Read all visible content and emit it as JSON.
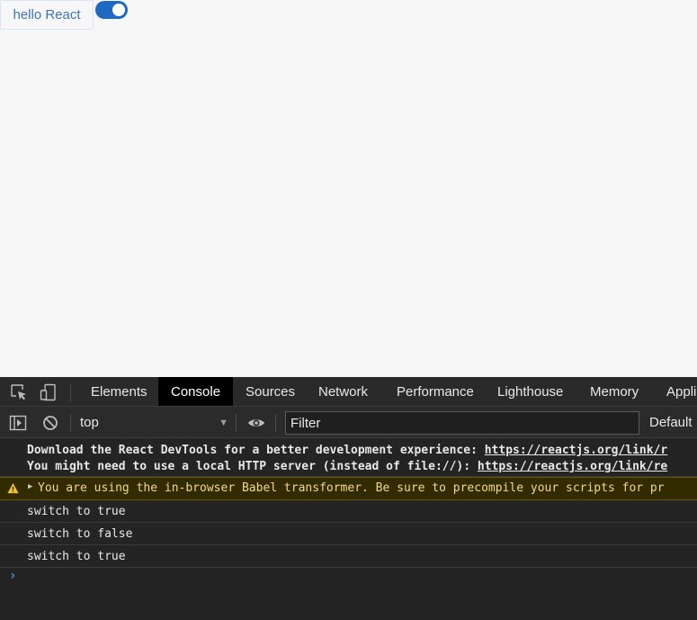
{
  "page": {
    "button_label": "hello React",
    "switch_state": "on",
    "switch_color": "#1e6ac2"
  },
  "devtools": {
    "tabs": [
      {
        "label": "Elements",
        "active": false
      },
      {
        "label": "Console",
        "active": true
      },
      {
        "label": "Sources",
        "active": false
      },
      {
        "label": "Network",
        "active": false
      },
      {
        "label": "Performance",
        "active": false
      },
      {
        "label": "Lighthouse",
        "active": false
      },
      {
        "label": "Memory",
        "active": false
      },
      {
        "label": "Appli",
        "active": false
      }
    ],
    "toolbar": {
      "context": "top",
      "filter_placeholder": "Filter",
      "levels": "Default"
    },
    "console": {
      "info_lines": [
        {
          "text": "Download the React DevTools for a better development experience: ",
          "link": "https://reactjs.org/link/r"
        },
        {
          "text": "You might need to use a local HTTP server (instead of file://): ",
          "link": "https://reactjs.org/link/re"
        }
      ],
      "warning": "You are using the in-browser Babel transformer. Be sure to precompile your scripts for pr",
      "logs": [
        "switch to true",
        "switch to false",
        "switch to true"
      ],
      "prompt": "›"
    }
  }
}
